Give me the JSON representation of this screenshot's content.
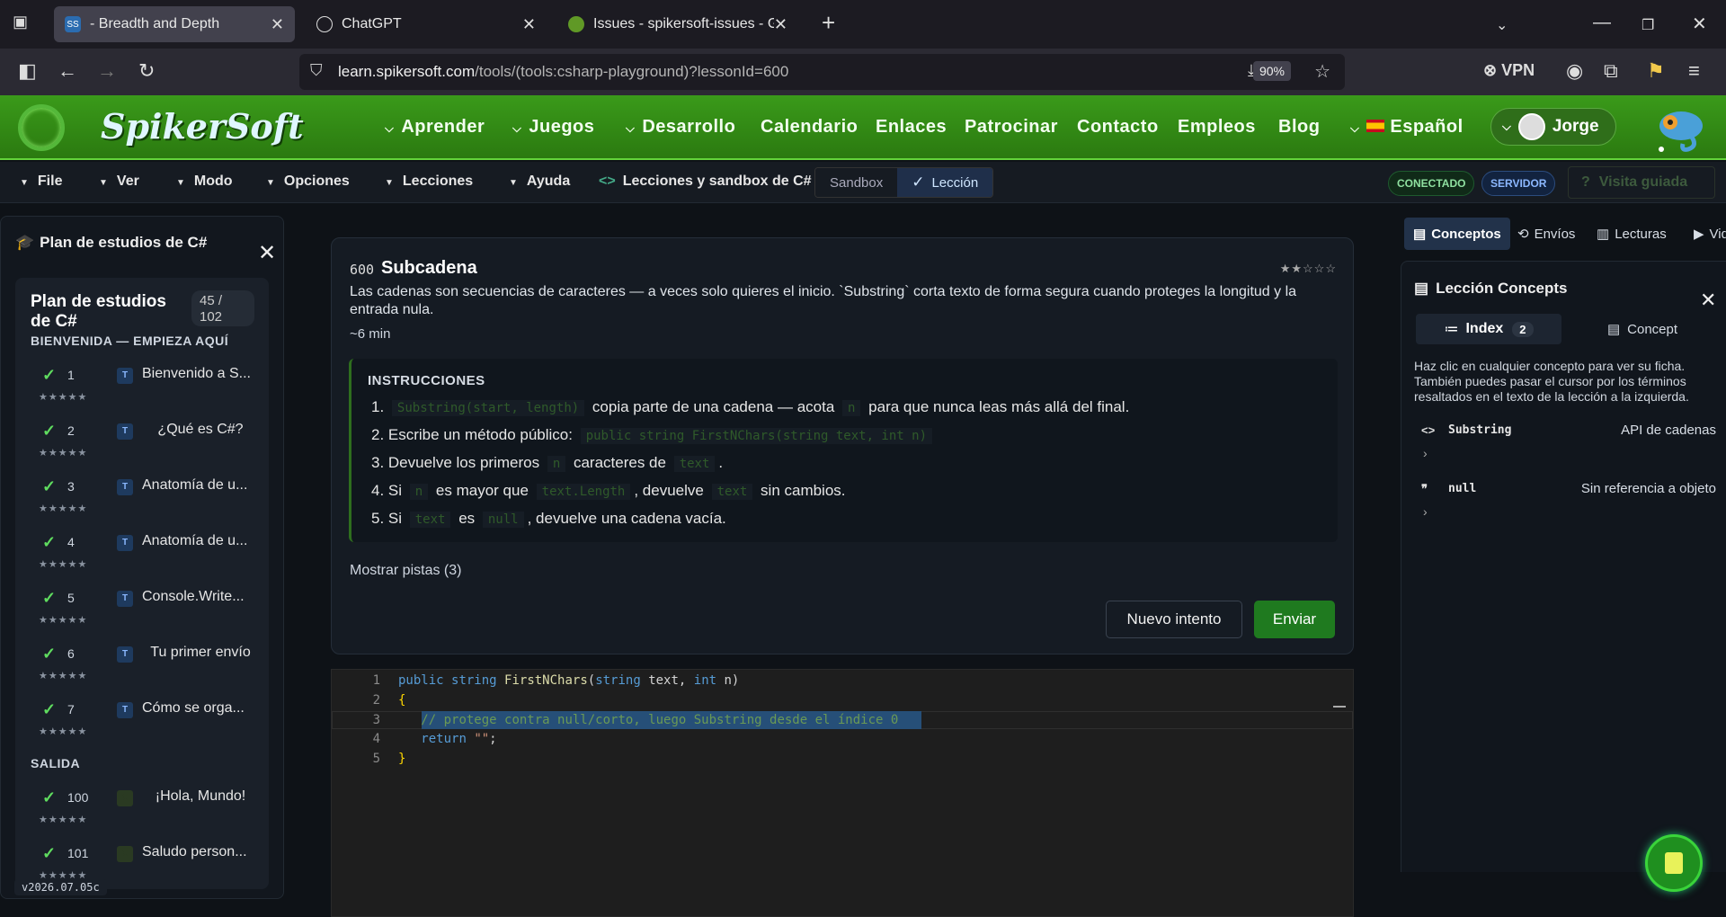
{
  "browser": {
    "tabs": [
      {
        "label": "- Breadth and Depth",
        "icon": "spikersoft-favicon",
        "active": true
      },
      {
        "label": "ChatGPT",
        "icon": "chatgpt-icon",
        "active": false
      },
      {
        "label": "Issues - spikersoft-issues - Gitea",
        "icon": "gitea-icon",
        "active": false
      }
    ],
    "url_domain": "learn.spikersoft.com",
    "url_path": "/tools/(tools:csharp-playground)?lessonId=600",
    "zoom": "90%",
    "vpn_label": "VPN"
  },
  "site": {
    "logo": "SpikerSoft",
    "nav": [
      {
        "label": "Aprender",
        "dropdown": true
      },
      {
        "label": "Juegos",
        "dropdown": true
      },
      {
        "label": "Desarrollo",
        "dropdown": true
      },
      {
        "label": "Calendario",
        "dropdown": false
      },
      {
        "label": "Enlaces",
        "dropdown": false
      },
      {
        "label": "Patrocinar",
        "dropdown": false
      },
      {
        "label": "Contacto",
        "dropdown": false
      },
      {
        "label": "Empleos",
        "dropdown": false
      },
      {
        "label": "Blog",
        "dropdown": false
      },
      {
        "label": "Español",
        "dropdown": true
      }
    ],
    "user": "Jorge"
  },
  "toolbar": {
    "menus": [
      "File",
      "Ver",
      "Modo",
      "Opciones",
      "Lecciones",
      "Ayuda"
    ],
    "breadcrumb": "Lecciones y sandbox de C#",
    "mode_sandbox": "Sandbox",
    "mode_lesson": "Lección",
    "status_connected": "CONECTADO",
    "status_server": "SERVIDOR",
    "guided_tour": "Visita guiada"
  },
  "sidebar": {
    "header": "Plan de estudios de C#",
    "title": "Plan de estudios de C#",
    "progress": "45 / 102",
    "sections": [
      {
        "name": "BIENVENIDA — EMPIEZA AQUÍ",
        "items": [
          {
            "num": "1",
            "title": "Bienvenido a S...",
            "stars": "★★★★★"
          },
          {
            "num": "2",
            "title": "¿Qué es C#?",
            "stars": "★★★★★"
          },
          {
            "num": "3",
            "title": "Anatomía de u...",
            "stars": "★★★★★"
          },
          {
            "num": "4",
            "title": "Anatomía de u...",
            "stars": "★★★★★"
          },
          {
            "num": "5",
            "title": "Console.Write...",
            "stars": "★★★★★"
          },
          {
            "num": "6",
            "title": "Tu primer envío",
            "stars": "★★★★★"
          },
          {
            "num": "7",
            "title": "Cómo se orga...",
            "stars": "★★★★★"
          }
        ]
      },
      {
        "name": "SALIDA",
        "items": [
          {
            "num": "100",
            "title": "¡Hola, Mundo!",
            "stars": "★★★★★"
          },
          {
            "num": "101",
            "title": "Saludo person...",
            "stars": "★★★★★"
          }
        ]
      }
    ],
    "version": "v2026.07.05c"
  },
  "lesson": {
    "id": "600",
    "title": "Subcadena",
    "difficulty_stars": "★★☆☆☆",
    "description": "Las cadenas son secuencias de caracteres — a veces solo quieres el inicio. `Substring` corta texto de forma segura cuando proteges la longitud y la entrada nula.",
    "duration": "~6 min",
    "instructions_header": "INSTRUCCIONES",
    "steps": [
      {
        "n": "1.",
        "parts": [
          {
            "code": "Substring(start, length)"
          },
          {
            "text": " copia parte de una cadena — acota "
          },
          {
            "code": "n"
          },
          {
            "text": " para que nunca leas más allá del final."
          }
        ]
      },
      {
        "n": "2.",
        "parts": [
          {
            "text": "Escribe un método público: "
          },
          {
            "code": "public string FirstNChars(string text, int n)"
          }
        ]
      },
      {
        "n": "3.",
        "parts": [
          {
            "text": "Devuelve los primeros "
          },
          {
            "code": "n"
          },
          {
            "text": " caracteres de "
          },
          {
            "code": "text"
          },
          {
            "text": "."
          }
        ]
      },
      {
        "n": "4.",
        "parts": [
          {
            "text": "Si "
          },
          {
            "code": "n"
          },
          {
            "text": " es mayor que "
          },
          {
            "code": "text.Length"
          },
          {
            "text": ", devuelve "
          },
          {
            "code": "text"
          },
          {
            "text": " sin cambios."
          }
        ]
      },
      {
        "n": "5.",
        "parts": [
          {
            "text": "Si "
          },
          {
            "code": "text"
          },
          {
            "text": " es "
          },
          {
            "code": "null"
          },
          {
            "text": ", devuelve una cadena vacía."
          }
        ]
      }
    ],
    "hints": "Mostrar pistas (3)",
    "retry": "Nuevo intento",
    "submit": "Enviar"
  },
  "editor": {
    "lines": [
      "public string FirstNChars(string text, int n)",
      "{",
      "   // protege contra null/corto, luego Substring desde el índice 0",
      "   return \"\";",
      "}"
    ]
  },
  "right_panel": {
    "tabs": [
      "Conceptos",
      "Envíos",
      "Lecturas",
      "Vid"
    ],
    "title": "Lección Concepts",
    "subtab_index": "Index",
    "index_count": "2",
    "subtab_concept": "Concept",
    "hint": "Haz clic en cualquier concepto para ver su ficha. También puedes pasar el cursor por los términos resaltados en el texto de la lección a la izquierda.",
    "concepts": [
      {
        "icon": "<>",
        "name": "Substring",
        "desc": "API de cadenas"
      },
      {
        "icon": "❞",
        "name": "null",
        "desc": "Sin referencia a objeto"
      }
    ]
  }
}
